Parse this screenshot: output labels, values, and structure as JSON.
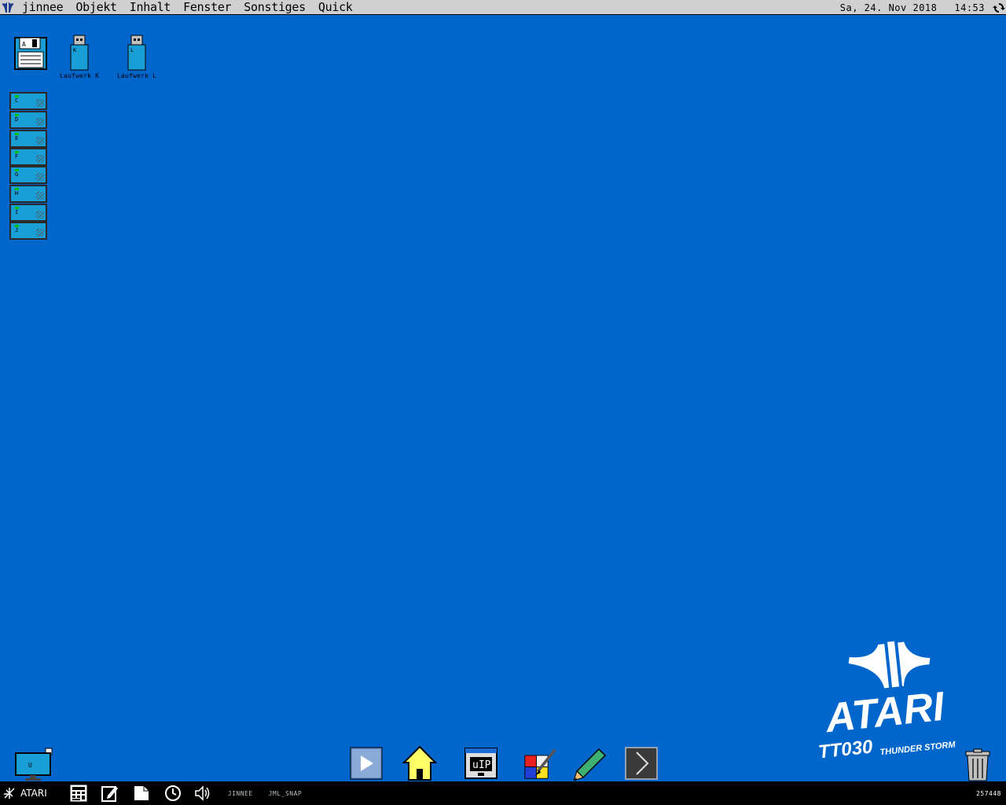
{
  "menubar": {
    "items": [
      "jinnee",
      "Objekt",
      "Inhalt",
      "Fenster",
      "Sonstiges",
      "Quick"
    ],
    "date": "Sa, 24. Nov 2018",
    "time": "14:53"
  },
  "desktop": {
    "floppy": {
      "letter": "A",
      "label": ""
    },
    "usb_drives": [
      {
        "letter": "K",
        "label": "Laufwerk K"
      },
      {
        "letter": "L",
        "label": "Laufwerk L"
      }
    ],
    "hard_drives": [
      "C",
      "D",
      "E",
      "F",
      "G",
      "H",
      "I",
      "J"
    ],
    "monitor_letter": "U"
  },
  "brand": {
    "logo": "ATARI",
    "model": "TT030",
    "edition": "THUNDER STORM"
  },
  "dock": {
    "icons": [
      "play-icon",
      "home-icon",
      "uip-icon",
      "paint-icon",
      "pencil-icon",
      "chevron-right-icon"
    ]
  },
  "taskbar": {
    "start_label": "ATARI",
    "apps": [
      "JINNEE",
      "JML_SNAP"
    ],
    "memory": "257448"
  },
  "colors": {
    "desktop": "#0066cc",
    "menubar": "#d0d0d0",
    "drive": "#1a9ed6",
    "taskbar": "#000000"
  }
}
